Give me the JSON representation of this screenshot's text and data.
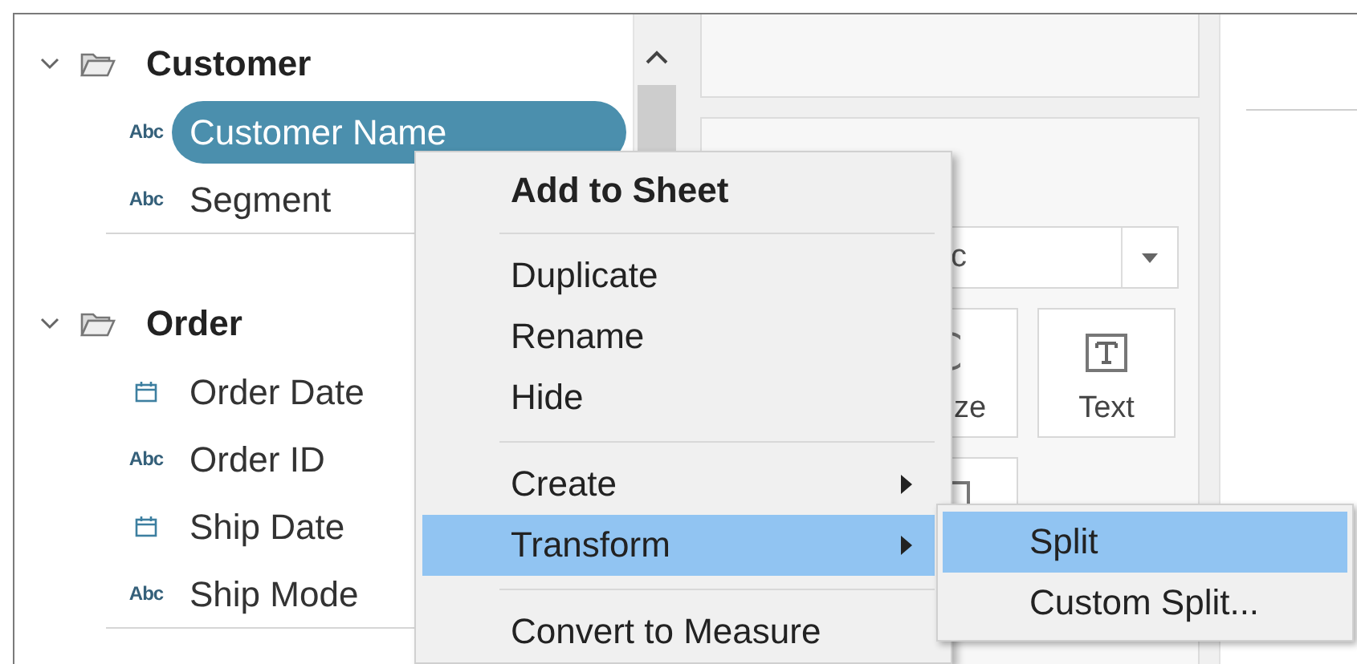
{
  "data_pane": {
    "groups": [
      {
        "name": "Customer",
        "expanded": true,
        "fields": [
          {
            "name": "Customer Name",
            "kind": "string",
            "type_label": "Abc",
            "selected": true
          },
          {
            "name": "Segment",
            "kind": "string",
            "type_label": "Abc",
            "selected": false
          }
        ]
      },
      {
        "name": "Order",
        "expanded": true,
        "fields": [
          {
            "name": "Order Date",
            "kind": "date",
            "selected": false
          },
          {
            "name": "Order ID",
            "kind": "string",
            "type_label": "Abc",
            "selected": false
          },
          {
            "name": "Ship Date",
            "kind": "date",
            "selected": false
          },
          {
            "name": "Ship Mode",
            "kind": "string",
            "type_label": "Abc",
            "selected": false
          }
        ]
      }
    ]
  },
  "marks_card": {
    "mark_type_fragment": "c",
    "size_fragment": "ze",
    "text_button": "Text"
  },
  "context_menu": {
    "items": [
      {
        "kind": "default",
        "label": "Add to Sheet",
        "selected": false
      },
      {
        "kind": "separator"
      },
      {
        "kind": "item",
        "label": "Duplicate",
        "selected": false
      },
      {
        "kind": "item",
        "label": "Rename",
        "selected": false
      },
      {
        "kind": "item",
        "label": "Hide",
        "selected": false
      },
      {
        "kind": "separator"
      },
      {
        "kind": "submenu",
        "label": "Create",
        "selected": false
      },
      {
        "kind": "submenu",
        "label": "Transform",
        "selected": true,
        "children": [
          {
            "kind": "item",
            "label": "Split",
            "selected": true
          },
          {
            "kind": "item",
            "label": "Custom Split...",
            "selected": false
          }
        ]
      },
      {
        "kind": "separator"
      },
      {
        "kind": "item",
        "label": "Convert to Measure",
        "selected": false
      }
    ]
  }
}
